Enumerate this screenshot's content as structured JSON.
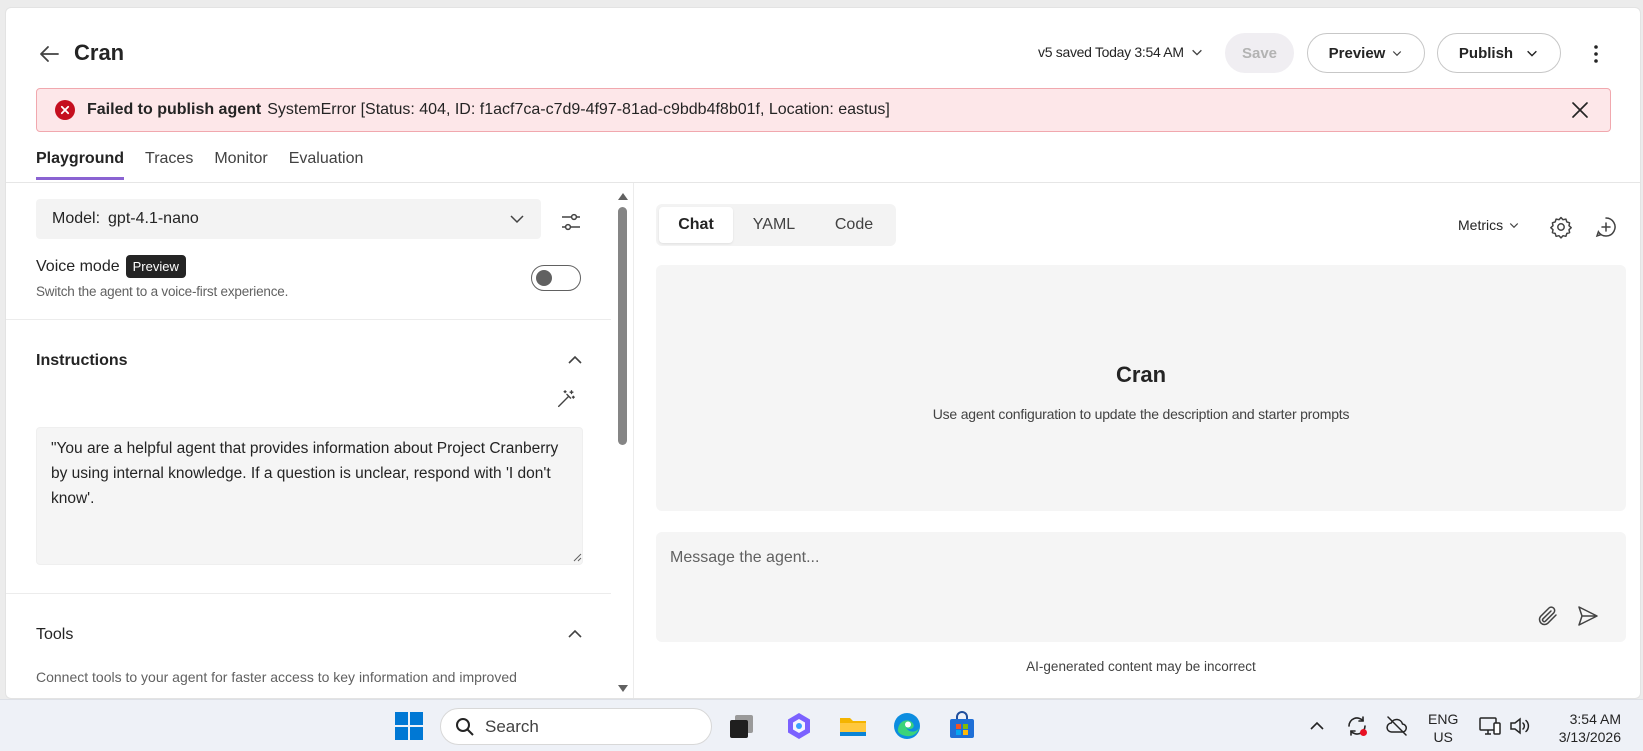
{
  "header": {
    "title": "Cran",
    "version_status": "v5 saved Today 3:54 AM",
    "save_label": "Save",
    "preview_label": "Preview",
    "publish_label": "Publish"
  },
  "error_banner": {
    "title": "Failed to publish agent",
    "message": "SystemError [Status: 404, ID: f1acf7ca-c7d9-4f97-81ad-c9bdb4f8b01f, Location: eastus]"
  },
  "tabs": [
    {
      "label": "Playground",
      "active": true
    },
    {
      "label": "Traces",
      "active": false
    },
    {
      "label": "Monitor",
      "active": false
    },
    {
      "label": "Evaluation",
      "active": false
    }
  ],
  "config": {
    "model_label": "Model:",
    "model_value": "gpt-4.1-nano",
    "voice_mode_label": "Voice mode",
    "voice_mode_badge": "Preview",
    "voice_mode_description": "Switch the agent to a voice-first experience.",
    "voice_mode_enabled": false,
    "instructions_title": "Instructions",
    "instructions_text": "\"You are a helpful agent that provides information about Project Cranberry by using internal knowledge. If a question is unclear, respond with 'I don't know'.",
    "tools_title": "Tools",
    "tools_description": "Connect tools to your agent for faster access to key information and improved"
  },
  "chat": {
    "tabs": [
      {
        "label": "Chat",
        "active": true
      },
      {
        "label": "YAML",
        "active": false
      },
      {
        "label": "Code",
        "active": false
      }
    ],
    "metrics_label": "Metrics",
    "agent_name": "Cran",
    "agent_hint": "Use agent configuration to update the description and starter prompts",
    "message_placeholder": "Message the agent...",
    "disclaimer": "AI-generated content may be incorrect"
  },
  "taskbar": {
    "search_label": "Search",
    "lang_line1": "ENG",
    "lang_line2": "US",
    "time": "3:54 AM",
    "date": "3/13/2026"
  },
  "colors": {
    "accent": "#8a63d2",
    "error_bg": "#fde7e9",
    "error_icon": "#c50f1f"
  }
}
